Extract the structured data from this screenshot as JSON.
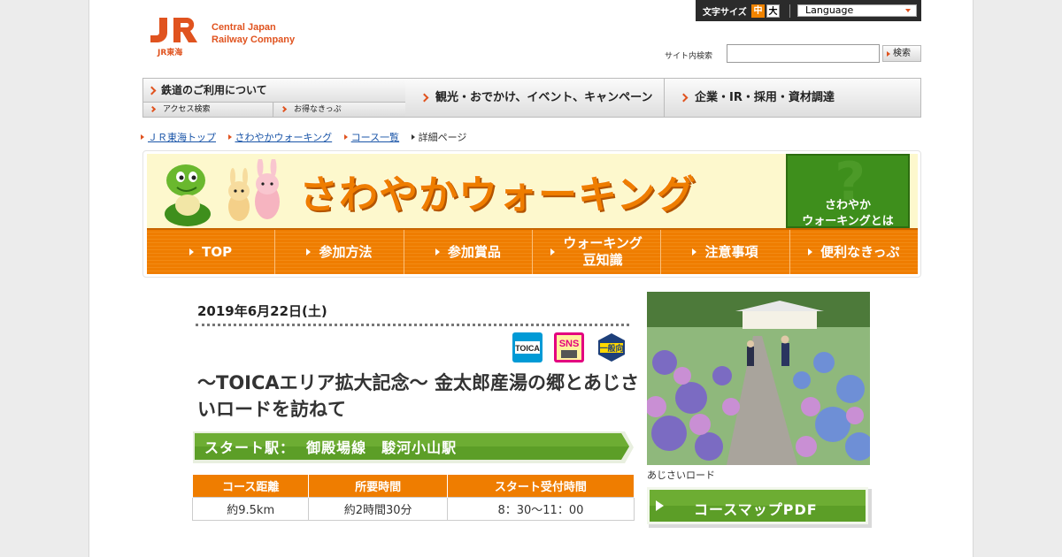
{
  "utility": {
    "font_size_label": "文字サイズ",
    "font_size_medium": "中",
    "font_size_large": "大",
    "language": "Language"
  },
  "logo": {
    "mark": "JR",
    "sub": "JR東海",
    "english": "Central Japan\nRailway Company"
  },
  "search": {
    "label": "サイト内検索",
    "value": "",
    "button": "検索"
  },
  "gnav": {
    "rail": "鉄道のご利用について",
    "access": "アクセス検索",
    "tickets": "お得なきっぷ",
    "sightseeing": "観光・おでかけ、イベント、キャンペーン",
    "corporate": "企業・IR・採用・資材調達"
  },
  "breadcrumb": [
    "ＪＲ東海トップ",
    "さわやかウォーキング",
    "コース一覧",
    "詳細ページ"
  ],
  "banner": {
    "title": "さわやかウォーキング",
    "about": "さわやか\nウォーキングとは",
    "nav": [
      "TOP",
      "参加方法",
      "参加賞品",
      "ウォーキング\n豆知識",
      "注意事項",
      "便利なきっぷ"
    ]
  },
  "event": {
    "date": "2019年6月22日(土)",
    "tags": [
      "TOICA",
      "SNS",
      "一般向"
    ],
    "title": "～TOICAエリア拡大記念～ 金太郎産湯の郷とあじさいロードを訪ねて",
    "start_station": "スタート駅：  御殿場線　駿河小山駅",
    "table": {
      "headers": [
        "コース距離",
        "所要時間",
        "スタート受付時間"
      ],
      "values": [
        "約9.5km",
        "約2時間30分",
        "8：30～11：00"
      ]
    },
    "photo_caption": "あじさいロード",
    "pdf_button": "コースマップPDF"
  },
  "colors": {
    "accent": "#ef7d00",
    "brand": "#e0531f",
    "green": "#5c9e27",
    "link": "#1a55a8"
  }
}
